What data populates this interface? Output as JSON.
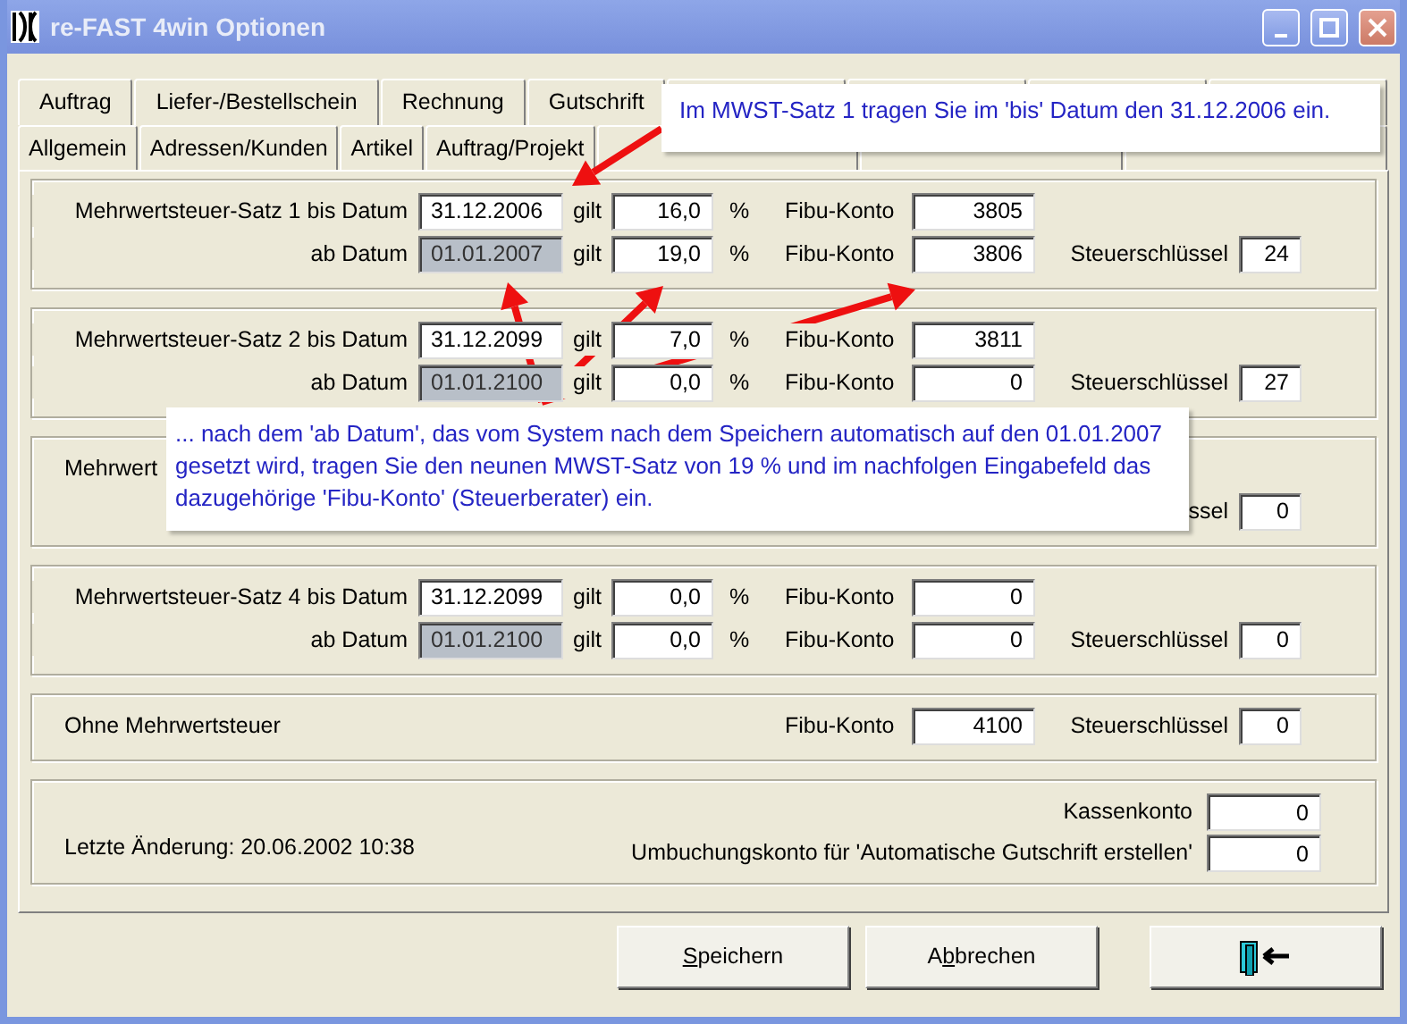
{
  "window": {
    "title": "re-FAST 4win Optionen"
  },
  "tab_rows": [
    [
      {
        "label": "Auftrag",
        "selected": false
      },
      {
        "label": "Liefer-/Bestellschein",
        "selected": false
      },
      {
        "label": "Rechnung",
        "selected": false
      },
      {
        "label": "Gutschrift",
        "selected": false
      },
      {
        "selected": false
      },
      {
        "selected": false
      },
      {
        "selected": false
      },
      {
        "selected": false
      }
    ],
    [
      {
        "label": "Allgemein",
        "selected": false
      },
      {
        "label": "Adressen/Kunden",
        "selected": false
      },
      {
        "label": "Artikel",
        "selected": false
      },
      {
        "label": "Auftrag/Projekt",
        "selected": false
      },
      {
        "selected": false
      },
      {
        "selected": false
      },
      {
        "selected": false
      }
    ]
  ],
  "sections": [
    {
      "kind": "rates",
      "rows": [
        {
          "kind": "rate",
          "label": "Mehrwertsteuer-Satz 1 bis Datum",
          "date": {
            "value": "31.12.2006",
            "disabled": false
          },
          "valid": "gilt",
          "percent": "16,0",
          "percent_sign": "%",
          "fibu_label": "Fibu-Konto",
          "fibu": "3805"
        },
        {
          "kind": "rate",
          "label": "ab Datum",
          "date": {
            "value": "01.01.2007",
            "disabled": true
          },
          "valid": "gilt",
          "percent": "19,0",
          "percent_sign": "%",
          "fibu_label": "Fibu-Konto",
          "fibu": "3806",
          "key_label": "Steuerschlüssel",
          "key": "24"
        }
      ]
    },
    {
      "kind": "rates",
      "rows": [
        {
          "kind": "rate",
          "label": "Mehrwertsteuer-Satz 2 bis Datum",
          "date": {
            "value": "31.12.2099",
            "disabled": false
          },
          "valid": "gilt",
          "percent": "7,0",
          "percent_sign": "%",
          "fibu_label": "Fibu-Konto",
          "fibu": "3811"
        },
        {
          "kind": "rate",
          "label": "ab Datum",
          "date": {
            "value": "01.01.2100",
            "disabled": true
          },
          "valid": "gilt",
          "percent": "0,0",
          "percent_sign": "%",
          "fibu_label": "Fibu-Konto",
          "fibu": "0",
          "key_label": "Steuerschlüssel",
          "key": "27"
        }
      ]
    },
    {
      "kind": "rates",
      "rows": [
        {
          "kind": "plain",
          "label": "Mehrwert"
        },
        {
          "kind": "rate",
          "key_label": "ssel",
          "key": "0"
        }
      ]
    },
    {
      "kind": "rates",
      "rows": [
        {
          "kind": "rate",
          "label": "Mehrwertsteuer-Satz 4 bis Datum",
          "date": {
            "value": "31.12.2099",
            "disabled": false
          },
          "valid": "gilt",
          "percent": "0,0",
          "percent_sign": "%",
          "fibu_label": "Fibu-Konto",
          "fibu": "0"
        },
        {
          "kind": "rate",
          "label": "ab Datum",
          "date": {
            "value": "01.01.2100",
            "disabled": true
          },
          "valid": "gilt",
          "percent": "0,0",
          "percent_sign": "%",
          "fibu_label": "Fibu-Konto",
          "fibu": "0",
          "key_label": "Steuerschlüssel",
          "key": "0"
        }
      ]
    },
    {
      "kind": "rates",
      "rows": [
        {
          "kind": "plain",
          "label": "Ohne Mehrwertsteuer",
          "fibu_label": "Fibu-Konto",
          "fibu": "4100",
          "key_label": "Steuerschlüssel",
          "key": "0"
        }
      ]
    },
    {
      "kind": "footer",
      "last_change": "Letzte Änderung: 20.06.2002 10:38",
      "accounts": [
        {
          "label": "Kassenkonto",
          "value": "0"
        },
        {
          "label": "Umbuchungskonto für 'Automatische Gutschrift erstellen'",
          "value": "0"
        }
      ]
    }
  ],
  "buttons": [
    {
      "kind": "text",
      "mnemonic": "S",
      "suffix": "peichern"
    },
    {
      "kind": "text",
      "prefix": "A",
      "mnemonic": "b",
      "suffix": "brechen"
    },
    {
      "kind": "exit"
    }
  ],
  "callouts": [
    {
      "text": "Im MWST-Satz 1 tragen Sie im 'bis' Datum den 31.12.2006 ein."
    },
    {
      "text": "... nach dem 'ab Datum', das vom System nach dem Speichern automatisch auf den 01.01.2007 gesetzt wird, tragen Sie den neunen MWST-Satz von 19 % und im nachfolgen Eingabefeld das dazugehörige 'Fibu-Konto' (Steuerberater) ein."
    }
  ]
}
